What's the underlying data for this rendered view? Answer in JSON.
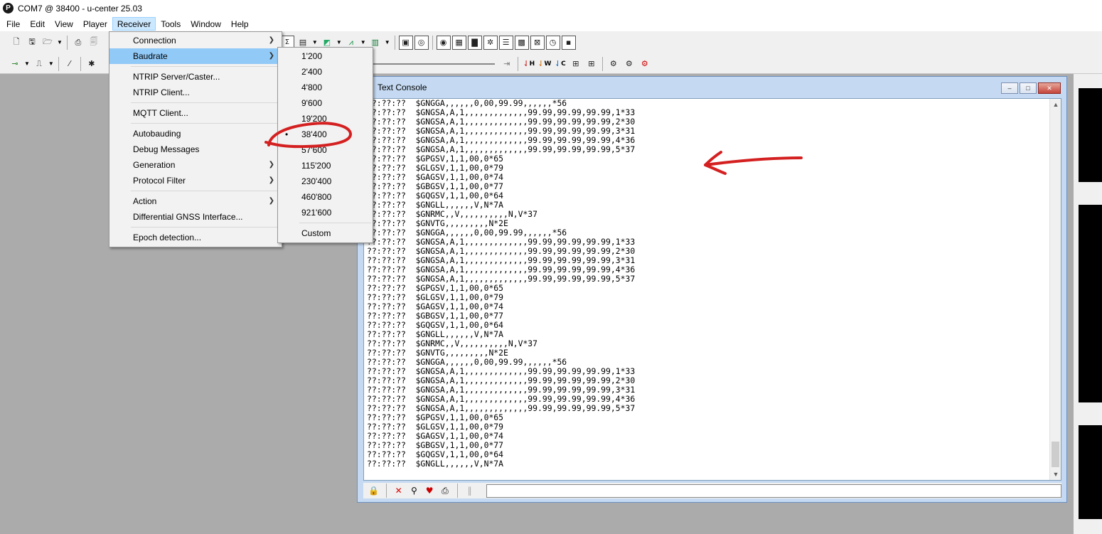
{
  "window": {
    "title": "COM7 @ 38400 - u-center 25.03",
    "app_icon_letter": "P"
  },
  "menubar": [
    "File",
    "Edit",
    "View",
    "Player",
    "Receiver",
    "Tools",
    "Window",
    "Help"
  ],
  "receiver_menu": {
    "groups": [
      [
        {
          "label": "Connection",
          "submenu": true
        },
        {
          "label": "Baudrate",
          "submenu": true,
          "highlighted": true
        }
      ],
      [
        {
          "label": "NTRIP Server/Caster...",
          "submenu": false
        },
        {
          "label": "NTRIP Client...",
          "submenu": false
        }
      ],
      [
        {
          "label": "MQTT Client...",
          "submenu": false
        }
      ],
      [
        {
          "label": "Autobauding",
          "submenu": false
        },
        {
          "label": "Debug Messages",
          "submenu": false
        },
        {
          "label": "Generation",
          "submenu": true
        },
        {
          "label": "Protocol Filter",
          "submenu": true
        }
      ],
      [
        {
          "label": "Action",
          "submenu": true
        },
        {
          "label": "Differential GNSS Interface...",
          "submenu": false
        }
      ],
      [
        {
          "label": "Epoch detection...",
          "submenu": false
        }
      ]
    ]
  },
  "baudrate_menu": {
    "items": [
      "1'200",
      "2'400",
      "4'800",
      "9'600",
      "19'200",
      "38'400",
      "57'600",
      "115'200",
      "230'400",
      "460'800",
      "921'600",
      "Custom"
    ],
    "selected": "38'400",
    "separator_before": "Custom"
  },
  "console": {
    "title": "Text Console",
    "lines": [
      "??:??:??  $GNGGA,,,,,,0,00,99.99,,,,,,*56",
      "??:??:??  $GNGSA,A,1,,,,,,,,,,,,,99.99,99.99,99.99,1*33",
      "??:??:??  $GNGSA,A,1,,,,,,,,,,,,,99.99,99.99,99.99,2*30",
      "??:??:??  $GNGSA,A,1,,,,,,,,,,,,,99.99,99.99,99.99,3*31",
      "??:??:??  $GNGSA,A,1,,,,,,,,,,,,,99.99,99.99,99.99,4*36",
      "??:??:??  $GNGSA,A,1,,,,,,,,,,,,,99.99,99.99,99.99,5*37",
      "??:??:??  $GPGSV,1,1,00,0*65",
      "??:??:??  $GLGSV,1,1,00,0*79",
      "??:??:??  $GAGSV,1,1,00,0*74",
      "??:??:??  $GBGSV,1,1,00,0*77",
      "??:??:??  $GQGSV,1,1,00,0*64",
      "??:??:??  $GNGLL,,,,,,V,N*7A",
      "??:??:??  $GNRMC,,V,,,,,,,,,,N,V*37",
      "??:??:??  $GNVTG,,,,,,,,,N*2E",
      "??:??:??  $GNGGA,,,,,,0,00,99.99,,,,,,*56",
      "??:??:??  $GNGSA,A,1,,,,,,,,,,,,,99.99,99.99,99.99,1*33",
      "??:??:??  $GNGSA,A,1,,,,,,,,,,,,,99.99,99.99,99.99,2*30",
      "??:??:??  $GNGSA,A,1,,,,,,,,,,,,,99.99,99.99,99.99,3*31",
      "??:??:??  $GNGSA,A,1,,,,,,,,,,,,,99.99,99.99,99.99,4*36",
      "??:??:??  $GNGSA,A,1,,,,,,,,,,,,,99.99,99.99,99.99,5*37",
      "??:??:??  $GPGSV,1,1,00,0*65",
      "??:??:??  $GLGSV,1,1,00,0*79",
      "??:??:??  $GAGSV,1,1,00,0*74",
      "??:??:??  $GBGSV,1,1,00,0*77",
      "??:??:??  $GQGSV,1,1,00,0*64",
      "??:??:??  $GNGLL,,,,,,V,N*7A",
      "??:??:??  $GNRMC,,V,,,,,,,,,,N,V*37",
      "??:??:??  $GNVTG,,,,,,,,,N*2E",
      "??:??:??  $GNGGA,,,,,,0,00,99.99,,,,,,*56",
      "??:??:??  $GNGSA,A,1,,,,,,,,,,,,,99.99,99.99,99.99,1*33",
      "??:??:??  $GNGSA,A,1,,,,,,,,,,,,,99.99,99.99,99.99,2*30",
      "??:??:??  $GNGSA,A,1,,,,,,,,,,,,,99.99,99.99,99.99,3*31",
      "??:??:??  $GNGSA,A,1,,,,,,,,,,,,,99.99,99.99,99.99,4*36",
      "??:??:??  $GNGSA,A,1,,,,,,,,,,,,,99.99,99.99,99.99,5*37",
      "??:??:??  $GPGSV,1,1,00,0*65",
      "??:??:??  $GLGSV,1,1,00,0*79",
      "??:??:??  $GAGSV,1,1,00,0*74",
      "??:??:??  $GBGSV,1,1,00,0*77",
      "??:??:??  $GQGSV,1,1,00,0*64",
      "??:??:??  $GNGLL,,,,,,V,N*7A"
    ],
    "window_buttons": {
      "minimize": "–",
      "maximize": "□",
      "close": "✕"
    }
  },
  "toolbar_icons": {
    "row1": [
      "new-file-icon",
      "save-icon",
      "open-folder-icon",
      "print-icon",
      "print-preview-icon"
    ],
    "row2": [
      "connection-icon",
      "baud-wave-icon",
      "wand-icon",
      "debug-bug-icon"
    ],
    "row2_right": [
      "H",
      "W",
      "C"
    ]
  },
  "colors": {
    "annotation": "#d42020",
    "menu_highlight": "#91c9f7",
    "menubar_active": "#cce8ff"
  }
}
